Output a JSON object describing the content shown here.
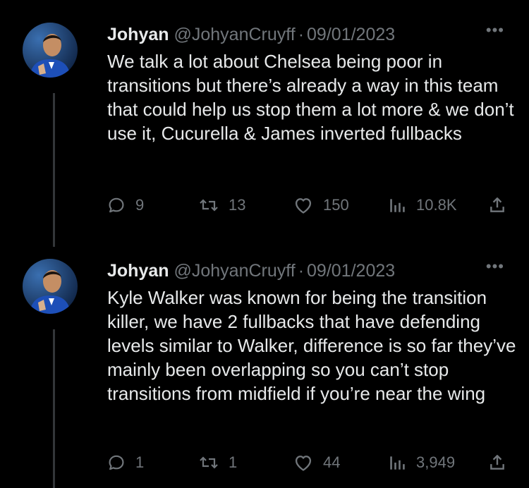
{
  "tweets": [
    {
      "author": {
        "name": "Johyan",
        "handle": "@JohyanCruyff"
      },
      "separator": "·",
      "date": "09/01/2023",
      "more_label": "•••",
      "text": "We talk a lot about Chelsea being poor in transitions but there’s already a way in this team that could help us stop them a lot more & we don’t use it, Cucurella & James inverted fullbacks",
      "stats": {
        "replies": "9",
        "retweets": "13",
        "likes": "150",
        "views": "10.8K"
      },
      "icons": {
        "reply": "reply-icon",
        "retweet": "retweet-icon",
        "like": "heart-icon",
        "views": "views-icon",
        "share": "share-icon"
      }
    },
    {
      "author": {
        "name": "Johyan",
        "handle": "@JohyanCruyff"
      },
      "separator": "·",
      "date": "09/01/2023",
      "more_label": "•••",
      "text": "Kyle Walker was known for being the transition killer, we have 2 fullbacks that have defending levels similar to Walker, difference is so far they’ve mainly been overlapping so you can’t stop transitions from midfield if you’re near the wing",
      "stats": {
        "replies": "1",
        "retweets": "1",
        "likes": "44",
        "views": "3,949"
      },
      "icons": {
        "reply": "reply-icon",
        "retweet": "retweet-icon",
        "like": "heart-icon",
        "views": "views-icon",
        "share": "share-icon"
      }
    }
  ],
  "colors": {
    "background": "#000000",
    "text": "#e7e9ea",
    "muted": "#71767b",
    "thread_line": "#333639"
  }
}
